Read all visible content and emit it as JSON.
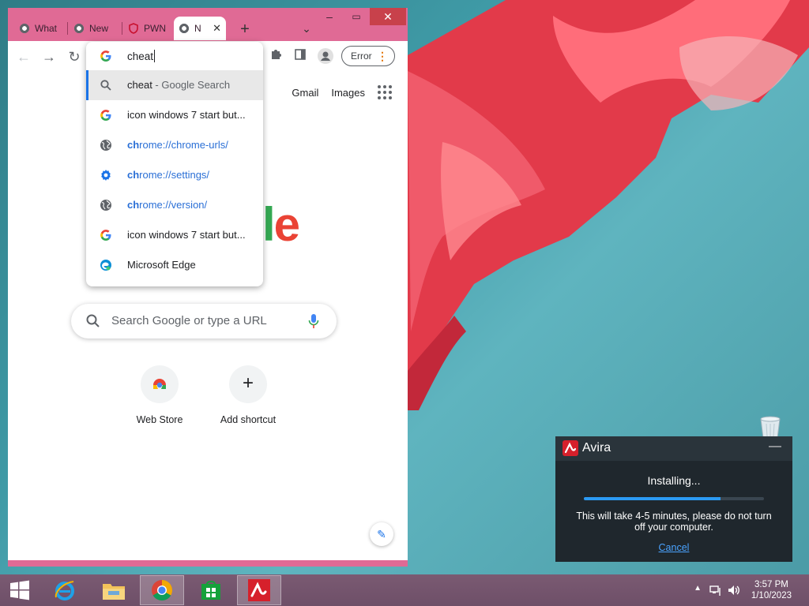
{
  "chrome": {
    "tabs": [
      {
        "label": "What",
        "active": false
      },
      {
        "label": "New",
        "active": false
      },
      {
        "label": "PWN",
        "active": false
      },
      {
        "label": "N",
        "active": true
      }
    ],
    "omnibox": {
      "query": "cheat",
      "suggestions": [
        {
          "icon": "search-icon",
          "bold": "cheat",
          "rest": " - Google Search",
          "kind": "search",
          "selected": true
        },
        {
          "icon": "google-icon",
          "bold": "",
          "rest": "icon windows 7 start but...",
          "kind": "history"
        },
        {
          "icon": "globe-icon",
          "bold": "ch",
          "rest": "rome://chrome-urls/",
          "kind": "url"
        },
        {
          "icon": "settings-gear-icon",
          "bold": "ch",
          "rest": "rome://settings/",
          "kind": "url"
        },
        {
          "icon": "globe-icon",
          "bold": "ch",
          "rest": "rome://version/",
          "kind": "url"
        },
        {
          "icon": "google-icon",
          "bold": "",
          "rest": "icon windows 7 start but...",
          "kind": "history"
        },
        {
          "icon": "edge-icon",
          "bold": "",
          "rest": "Microsoft Edge",
          "kind": "app"
        }
      ]
    },
    "profile_button": {
      "label": "Error"
    },
    "newtab": {
      "links": {
        "gmail": "Gmail",
        "images": "Images"
      },
      "logo_fragment": "le",
      "search_placeholder": "Search Google or type a URL",
      "shortcuts": [
        {
          "label": "Web Store"
        },
        {
          "label": "Add shortcut"
        }
      ]
    }
  },
  "avira": {
    "title": "Avira",
    "status": "Installing...",
    "progress": 0.76,
    "message": "This will take 4-5 minutes, please do not turn off your computer.",
    "cancel_label": "Cancel"
  },
  "taskbar": {
    "time": "3:57 PM",
    "date": "1/10/2023"
  },
  "colors": {
    "chrome_frame": "#e06a95",
    "avira_bg": "#1f272d",
    "avira_red": "#d6202b",
    "progress_blue": "#2b9af3",
    "link_blue": "#1a73e8"
  }
}
